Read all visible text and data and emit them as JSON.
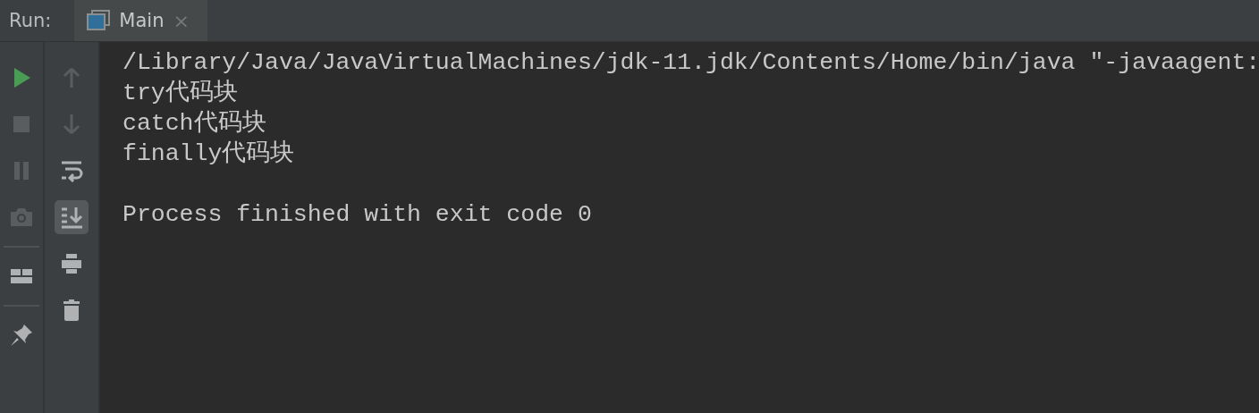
{
  "header": {
    "label": "Run:",
    "tabs": [
      {
        "label": "Main",
        "selected": true,
        "close": "×"
      }
    ]
  },
  "toolbar_left": [
    {
      "kind": "run",
      "disabled": false
    },
    {
      "kind": "stop",
      "disabled": true
    },
    {
      "kind": "pause",
      "disabled": true
    },
    {
      "kind": "camera",
      "disabled": true
    },
    {
      "kind": "separator"
    },
    {
      "kind": "layout",
      "disabled": false
    },
    {
      "kind": "separator"
    },
    {
      "kind": "pin",
      "disabled": false
    }
  ],
  "toolbar_right": [
    {
      "kind": "up",
      "disabled": true,
      "selected": false
    },
    {
      "kind": "down",
      "disabled": true,
      "selected": false
    },
    {
      "kind": "wrap",
      "disabled": false,
      "selected": false
    },
    {
      "kind": "scroll-end",
      "disabled": false,
      "selected": true
    },
    {
      "kind": "print",
      "disabled": false,
      "selected": false
    },
    {
      "kind": "trash",
      "disabled": false,
      "selected": false
    }
  ],
  "console": {
    "lines": [
      "/Library/Java/JavaVirtualMachines/jdk-11.jdk/Contents/Home/bin/java \"-javaagent:",
      "try代码块",
      "catch代码块",
      "finally代码块"
    ],
    "exit_message": "Process finished with exit code 0"
  }
}
